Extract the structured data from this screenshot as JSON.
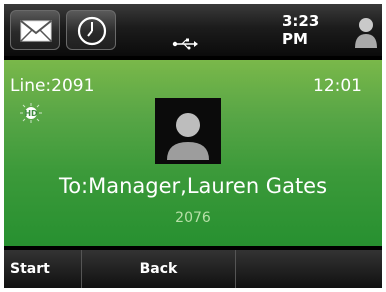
{
  "status_bar": {
    "time": "3:23 PM",
    "icons": [
      "envelope-icon",
      "clock-icon",
      "usb-icon",
      "user-icon"
    ]
  },
  "call": {
    "line": "Line:2091",
    "timer": "12:01",
    "hd_badge": "HD",
    "to": "To:Manager,Lauren Gates",
    "number": "2076"
  },
  "softkeys": [
    "Start",
    "Back",
    ""
  ],
  "colors": {
    "call_green": "#3c9a3a",
    "bar_dark": "#1c1c1c"
  }
}
